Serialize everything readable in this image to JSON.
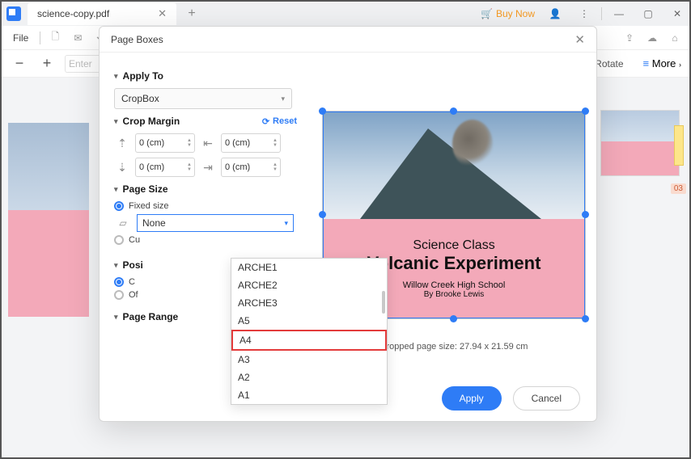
{
  "titlebar": {
    "tab_name": "science-copy.pdf",
    "buy_label": "Buy Now"
  },
  "menubar": {
    "file": "File",
    "rotate": "Rotate",
    "more": "More"
  },
  "toolbar": {
    "enter_placeholder": "Enter"
  },
  "thumbnails": {
    "page_number": "03"
  },
  "dialog": {
    "title": "Page Boxes",
    "apply_to": {
      "label": "Apply To",
      "value": "CropBox"
    },
    "crop_margin": {
      "label": "Crop Margin",
      "reset": "Reset",
      "top": "0 (cm)",
      "bottom": "0 (cm)",
      "left": "0 (cm)",
      "right": "0 (cm)"
    },
    "page_size": {
      "label": "Page Size",
      "fixed_label": "Fixed size",
      "custom_label": "Cu",
      "selected": "None",
      "options": [
        "ARCHE1",
        "ARCHE2",
        "ARCHE3",
        "A5",
        "A4",
        "A3",
        "A2",
        "A1"
      ]
    },
    "position": {
      "label": "Posi",
      "col_label": "C",
      "off_label": "Of"
    },
    "page_range": {
      "label": "Page Range"
    },
    "preview": {
      "line1": "Science Class",
      "line2": "Volcanic Experiment",
      "line3": "Willow Creek High School",
      "line4": "By Brooke Lewis",
      "cropped_text": "Cropped page size: 27.94 x 21.59 cm"
    },
    "buttons": {
      "apply": "Apply",
      "cancel": "Cancel"
    }
  }
}
